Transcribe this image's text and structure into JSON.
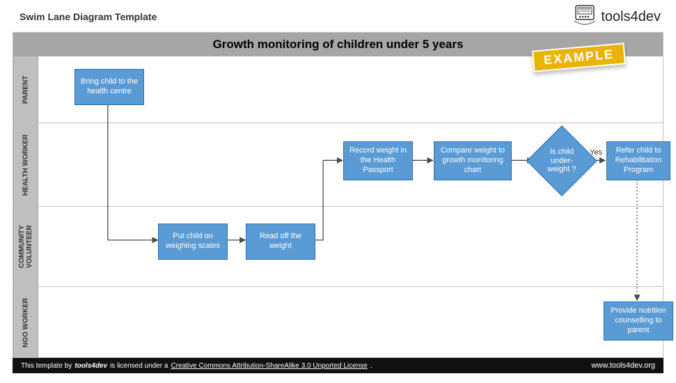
{
  "doc_title": "Swim Lane Diagram Template",
  "logo_text": "tools4dev",
  "diagram_title": "Growth monitoring of children under 5 years",
  "stamp": "EXAMPLE",
  "lanes": [
    {
      "label": "PARENT"
    },
    {
      "label": "HEALTH WORKER"
    },
    {
      "label": "COMMUNITY VOLUNTEER"
    },
    {
      "label": "NGO WORKER"
    }
  ],
  "nodes": {
    "n1": "Bring child to the health centre",
    "n2": "Put child on weighing scales",
    "n3": "Read off the weight",
    "n4": "Record weight in the Health Passport",
    "n5": "Compare weight to growth monitoring chart",
    "n6": "Is child under-weight ?",
    "n7": "Refer child to Rehabilitation Program",
    "n8": "Provide nutrition counselling to parent"
  },
  "edge_labels": {
    "yes": "Yes"
  },
  "footer": {
    "pre": "This template by",
    "brand": "tools4dev",
    "mid": "is licensed under a",
    "license": "Creative Commons Attribution-ShareAlike 3.0 Unported License",
    "post": ".",
    "url": "www.tools4dev.org"
  },
  "colors": {
    "node_fill": "#5b9bd5",
    "node_border": "#2e6da4",
    "titlebar": "#a6a6a6",
    "lane_label": "#bfbfbf",
    "stamp": "#eab308"
  }
}
